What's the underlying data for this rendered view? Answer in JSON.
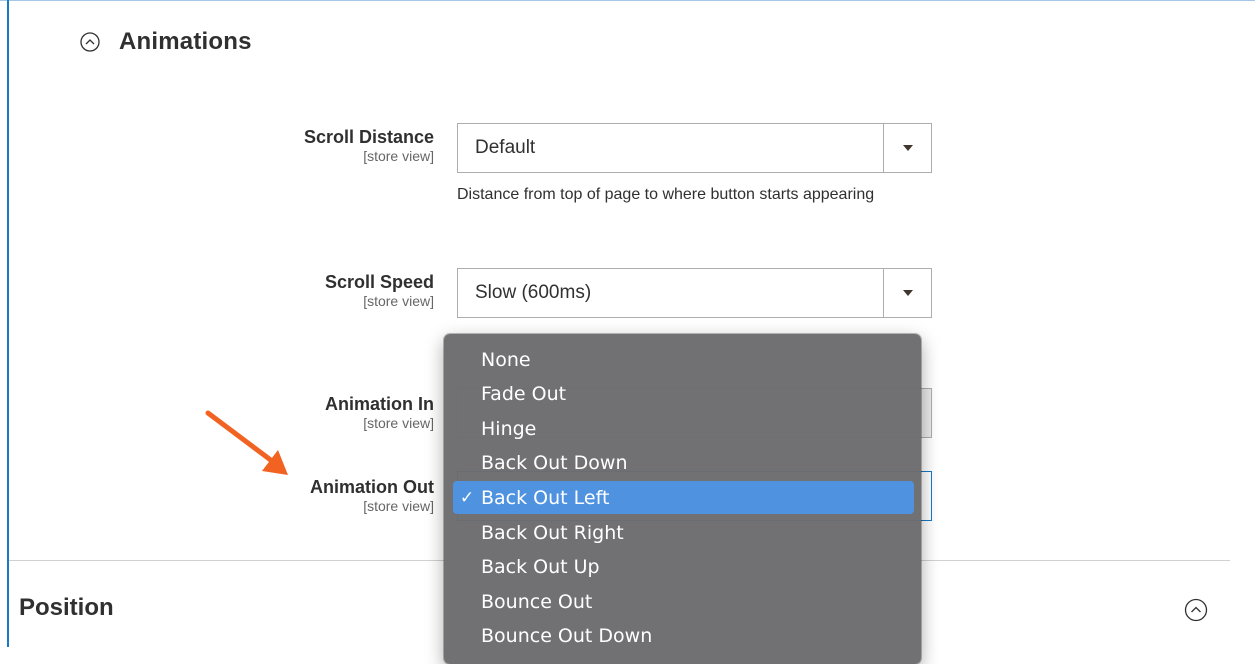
{
  "animations_section": {
    "title": "Animations"
  },
  "fields": {
    "scroll_distance": {
      "label": "Scroll Distance",
      "scope": "[store view]",
      "value": "Default",
      "note": "Distance from top of page to where button starts appearing"
    },
    "scroll_speed": {
      "label": "Scroll Speed",
      "scope": "[store view]",
      "value": "Slow (600ms)"
    },
    "animation_in": {
      "label": "Animation In",
      "scope": "[store view]"
    },
    "animation_out": {
      "label": "Animation Out",
      "scope": "[store view]"
    }
  },
  "dropdown": {
    "selected_mark": "✓",
    "options": [
      "None",
      "Fade Out",
      "Hinge",
      "Back Out Down",
      "Back Out Left",
      "Back Out Right",
      "Back Out Up",
      "Bounce Out",
      "Bounce Out Down"
    ],
    "selected_index": 4
  },
  "position_section": {
    "title": "Position"
  },
  "colors": {
    "accent": "#1979c3",
    "selected_item": "#4f93e0",
    "annotation_arrow": "#f26322"
  },
  "icons": {
    "collapse": "chevron-up-circle-icon",
    "select_arrow": "triangle-down-icon",
    "annotation": "arrow-annotation-icon"
  }
}
